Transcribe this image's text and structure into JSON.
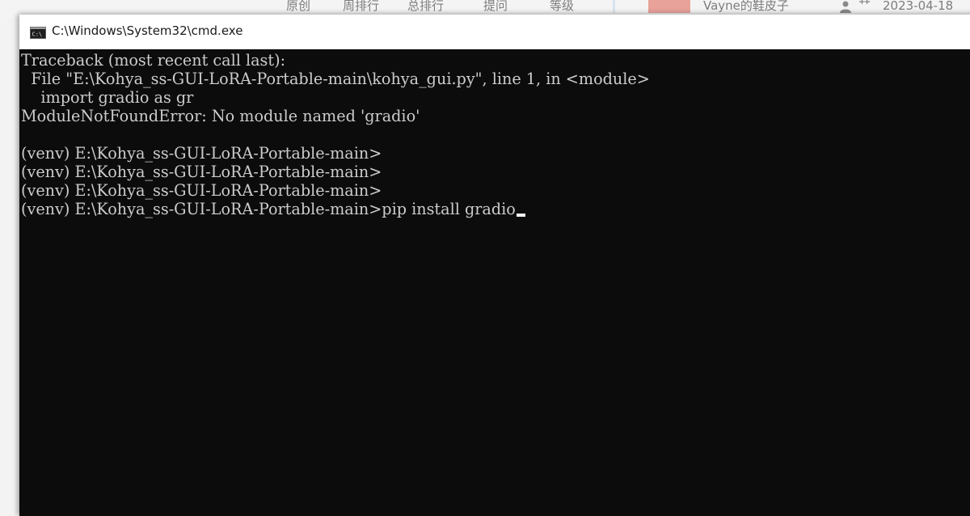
{
  "background": {
    "items": [
      {
        "label": "原创"
      },
      {
        "label": "周排行"
      },
      {
        "label": "总排行"
      },
      {
        "label": "提问"
      },
      {
        "label": "等级"
      }
    ],
    "author": "Vayne的鞋皮子",
    "date": "2023-04-18",
    "accent_color": "#e8a29a"
  },
  "window": {
    "title": "C:\\Windows\\System32\\cmd.exe",
    "icon": "cmd-icon"
  },
  "console": {
    "lines": [
      "Traceback (most recent call last):",
      "  File \"E:\\Kohya_ss-GUI-LoRA-Portable-main\\kohya_gui.py\", line 1, in <module>",
      "    import gradio as gr",
      "ModuleNotFoundError: No module named 'gradio'",
      "",
      "(venv) E:\\Kohya_ss-GUI-LoRA-Portable-main>",
      "(venv) E:\\Kohya_ss-GUI-LoRA-Portable-main>",
      "(venv) E:\\Kohya_ss-GUI-LoRA-Portable-main>",
      "(venv) E:\\Kohya_ss-GUI-LoRA-Portable-main>pip install gradio"
    ],
    "text_color": "#cccccc",
    "background_color": "#0c0c0c"
  }
}
